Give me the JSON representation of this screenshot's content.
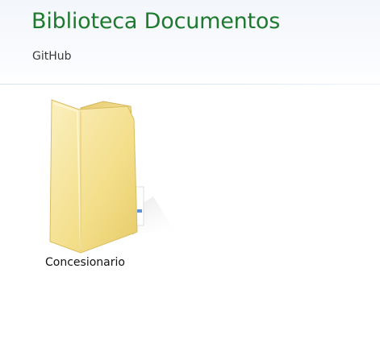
{
  "library": {
    "title": "Biblioteca Documentos",
    "subtitle": "GitHub"
  },
  "items": [
    {
      "label": "Concesionario",
      "icon": "folder-icon"
    }
  ],
  "colors": {
    "title": "#1e7a2e",
    "folder_light": "#f6e7a6",
    "folder_dark": "#e6c96a"
  }
}
